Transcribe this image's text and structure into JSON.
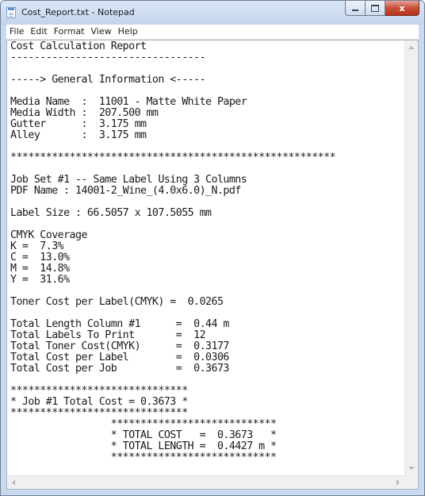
{
  "window": {
    "title": "Cost_Report.txt - Notepad",
    "controls": {
      "minimize": "",
      "maximize": "",
      "close": "x"
    }
  },
  "menu": {
    "items": [
      "File",
      "Edit",
      "Format",
      "View",
      "Help"
    ]
  },
  "document": {
    "lines": [
      "Cost Calculation Report",
      "---------------------------------",
      "",
      "-----> General Information <-----",
      "",
      "Media Name  :  11001 - Matte White Paper",
      "Media Width :  207.500 mm",
      "Gutter      :  3.175 mm",
      "Alley       :  3.175 mm",
      "",
      "*******************************************************",
      "",
      "Job Set #1 -- Same Label Using 3 Columns",
      "PDF Name : 14001-2_Wine_(4.0x6.0)_N.pdf",
      "",
      "Label Size : 66.5057 x 107.5055 mm",
      "",
      "CMYK Coverage",
      "K =  7.3%",
      "C =  13.0%",
      "M =  14.8%",
      "Y =  31.6%",
      "",
      "Toner Cost per Label(CMYK) =  0.0265",
      "",
      "Total Length Column #1      =  0.44 m",
      "Total Labels To Print       =  12",
      "Total Toner Cost(CMYK)      =  0.3177",
      "Total Cost per Label        =  0.0306",
      "Total Cost per Job          =  0.3673",
      "",
      "******************************",
      "* Job #1 Total Cost = 0.3673 *",
      "******************************",
      "                 ****************************",
      "                 * TOTAL COST   =  0.3673   *",
      "                 * TOTAL LENGTH =  0.4427 m *",
      "                 ****************************"
    ]
  }
}
